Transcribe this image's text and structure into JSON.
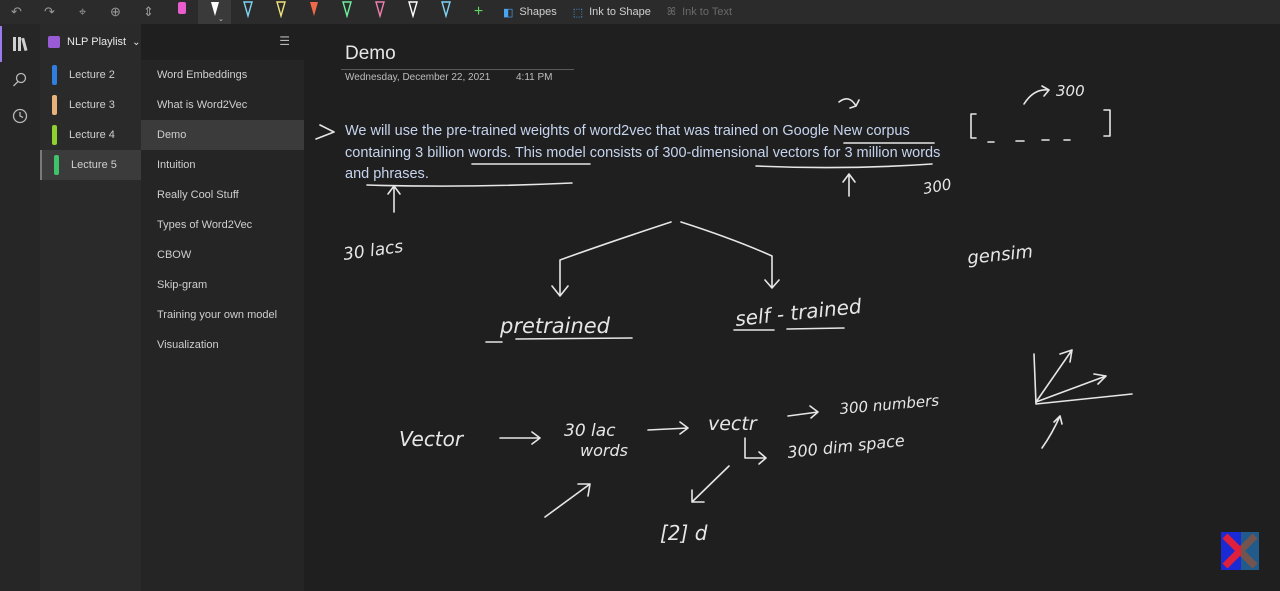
{
  "toolbar": {
    "shapes_label": "Shapes",
    "ink_to_shape_label": "Ink to Shape",
    "ink_to_text_label": "Ink to Text",
    "pens": [
      "#e85ccb",
      "#ffffff",
      "#7fd3f3",
      "#f1e27a",
      "#f06a4a",
      "#6ef0a0",
      "#f07fb0",
      "#ffffff",
      "#7fd3f3"
    ]
  },
  "notebook": {
    "name": "NLP Playlist"
  },
  "sections": [
    {
      "label": "Lecture 2",
      "color": "#2f7fe0"
    },
    {
      "label": "Lecture 3",
      "color": "#e8b27a"
    },
    {
      "label": "Lecture 4",
      "color": "#8fcf2f"
    },
    {
      "label": "Lecture 5",
      "color": "#3fc36a"
    }
  ],
  "pages": [
    "Word Embeddings",
    "What is Word2Vec",
    "Demo",
    "Intuition",
    "Really Cool Stuff",
    "Types of Word2Vec",
    "CBOW",
    "Skip-gram",
    "Training your own model",
    "Visualization"
  ],
  "page": {
    "title": "Demo",
    "date": "Wednesday, December 22, 2021",
    "time": "4:11 PM",
    "text_part1": "We will use the pre-trained weights of word2vec that was trained on ",
    "text_google": "Google New",
    "text_part2": " corpus containing ",
    "text_billion": "3 billion words.",
    "text_part3": " This model consists of ",
    "text_dims": "300-dimensional vectors",
    "text_part4": " for ",
    "text_million": "3 million words and phrases",
    "text_part5": "."
  },
  "handwriting": {
    "lacs": "30 lacs",
    "three_hundred_top": "300",
    "three_hundred_side": "300",
    "gensim": "gensim",
    "pretrained": "pretrained",
    "self_trained": "self - trained",
    "vector": "Vector",
    "thirty_lac": "30 lac",
    "words": "words",
    "vectr": "vectr",
    "three_hundred_numbers": "300 numbers",
    "three_hundred_dim": "300 dim space",
    "two_d": "[2] d"
  }
}
